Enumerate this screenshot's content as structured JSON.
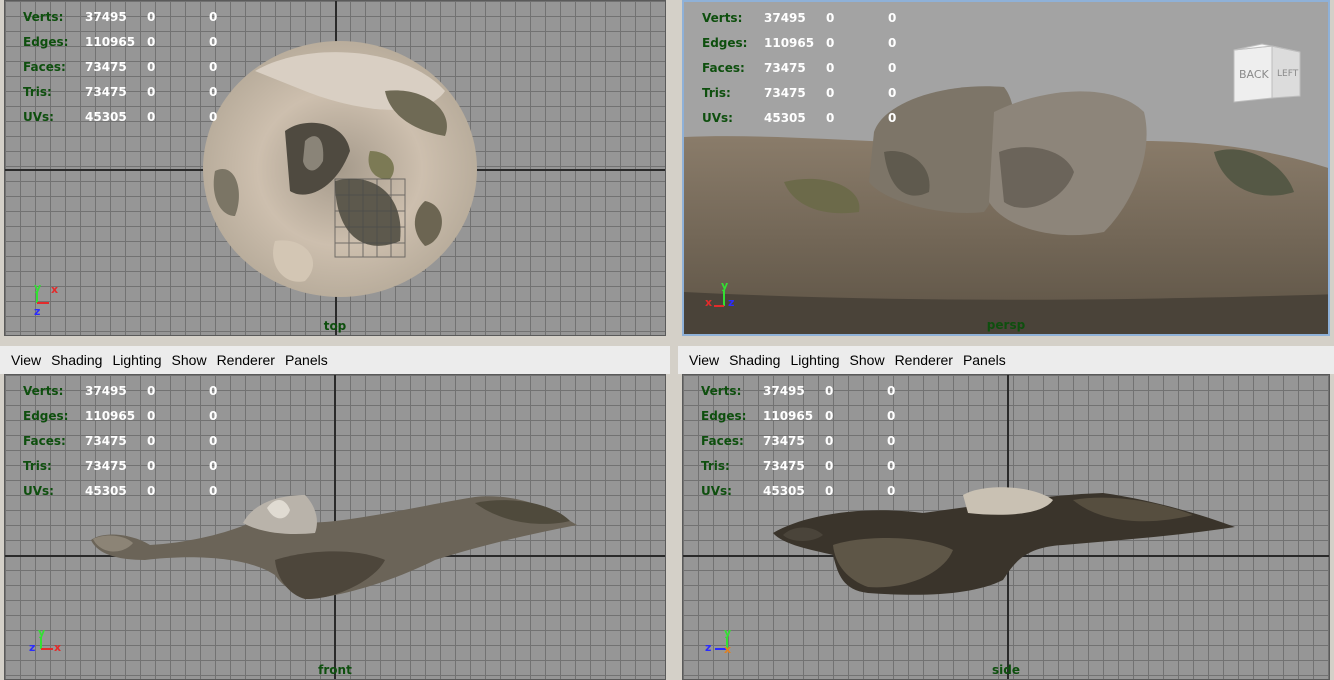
{
  "menus": [
    "View",
    "Shading",
    "Lighting",
    "Show",
    "Renderer",
    "Panels"
  ],
  "hud": [
    {
      "label": "Verts:",
      "value": "37495",
      "sel": "0",
      "comp": "0"
    },
    {
      "label": "Edges:",
      "value": "110965",
      "sel": "0",
      "comp": "0"
    },
    {
      "label": "Faces:",
      "value": "73475",
      "sel": "0",
      "comp": "0"
    },
    {
      "label": "Tris:",
      "value": "73475",
      "sel": "0",
      "comp": "0"
    },
    {
      "label": "UVs:",
      "value": "45305",
      "sel": "0",
      "comp": "0"
    }
  ],
  "viewports": {
    "top": {
      "camera": "top",
      "axis_a": "y",
      "axis_b": "x",
      "axis_c": "z"
    },
    "persp": {
      "camera": "persp",
      "axis_a": "y",
      "axis_b": "x",
      "axis_c": "z"
    },
    "front": {
      "camera": "front",
      "axis_a": "y",
      "axis_b": "z",
      "axis_c": "x"
    },
    "side": {
      "camera": "side",
      "axis_a": "y",
      "axis_b": "z",
      "axis_c": "x"
    }
  },
  "viewcube": {
    "face_back": "BACK",
    "face_left": "LEFT"
  },
  "colors": {
    "hud_label": "#0e4f0e",
    "hud_value": "#ffffff",
    "axis_x": "#e32b2b",
    "axis_y": "#33e033",
    "axis_z": "#2b2bff",
    "active_border": "#8fb1d8"
  }
}
